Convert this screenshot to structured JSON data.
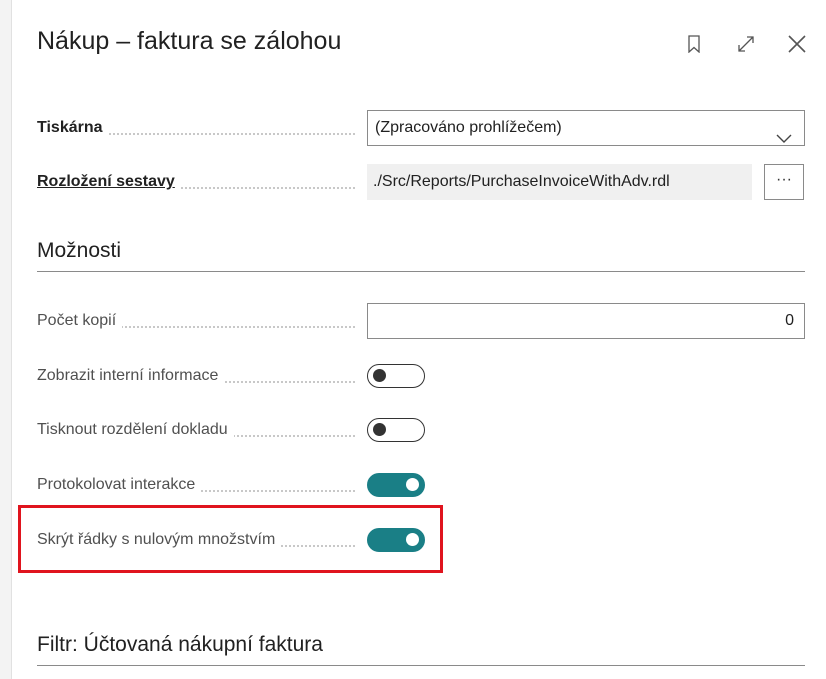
{
  "dialog": {
    "title": "Nákup – faktura se zálohou",
    "header_icons": [
      "bookmark-icon",
      "expand-icon",
      "close-icon"
    ]
  },
  "fields": {
    "printer": {
      "label": "Tiskárna",
      "value": "(Zpracováno prohlížečem)"
    },
    "layout": {
      "label": "Rozložení sestavy",
      "value": "./Src/Reports/PurchaseInvoiceWithAdv.rdl",
      "more_label": "···"
    }
  },
  "options": {
    "title": "Možnosti",
    "copies": {
      "label": "Počet kopií",
      "value": "0"
    },
    "show_internal": {
      "label": "Zobrazit interní informace",
      "state": "off"
    },
    "print_split": {
      "label": "Tisknout rozdělení dokladu",
      "state": "off"
    },
    "log_interaction": {
      "label": "Protokolovat interakce",
      "state": "on"
    },
    "hide_zero_lines": {
      "label": "Skrýt řádky s nulovým množstvím",
      "state": "on"
    }
  },
  "filter": {
    "title": "Filtr: Účtovaná nákupní faktura"
  },
  "colors": {
    "accent": "#1a7f86",
    "highlight": "#e0141e"
  }
}
